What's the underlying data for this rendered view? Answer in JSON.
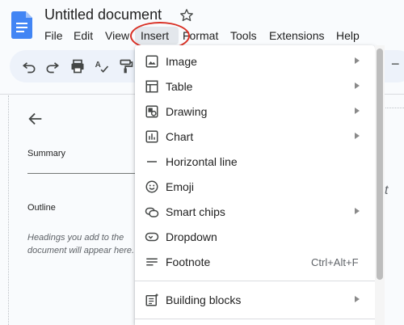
{
  "header": {
    "title": "Untitled document",
    "menus": [
      "File",
      "Edit",
      "View",
      "Insert",
      "Format",
      "Tools",
      "Extensions",
      "Help"
    ],
    "highlighted_menu": "Insert"
  },
  "toolbar": {
    "icons": [
      "undo-icon",
      "redo-icon",
      "print-icon",
      "spellcheck-icon",
      "paint-format-icon"
    ]
  },
  "outline_panel": {
    "summary_label": "Summary",
    "outline_label": "Outline",
    "hint": "Headings you add to the document will appear here."
  },
  "insert_menu": {
    "items": [
      {
        "label": "Image",
        "icon": "image-icon",
        "has_submenu": true
      },
      {
        "label": "Table",
        "icon": "table-icon",
        "has_submenu": true
      },
      {
        "label": "Drawing",
        "icon": "drawing-icon",
        "has_submenu": true
      },
      {
        "label": "Chart",
        "icon": "chart-icon",
        "has_submenu": true
      },
      {
        "label": "Horizontal line",
        "icon": "horizontal-line-icon",
        "has_submenu": false
      },
      {
        "label": "Emoji",
        "icon": "emoji-icon",
        "has_submenu": false
      },
      {
        "label": "Smart chips",
        "icon": "smart-chips-icon",
        "has_submenu": true
      },
      {
        "label": "Dropdown",
        "icon": "dropdown-icon",
        "has_submenu": false
      },
      {
        "label": "Footnote",
        "icon": "footnote-icon",
        "has_submenu": false,
        "shortcut": "Ctrl+Alt+F"
      },
      {
        "label": "Building blocks",
        "icon": "building-blocks-icon",
        "has_submenu": true
      }
    ]
  },
  "colors": {
    "docs_blue": "#4285f4",
    "highlight_ring": "#d93025",
    "toolbar_bg": "#edf2fa"
  }
}
